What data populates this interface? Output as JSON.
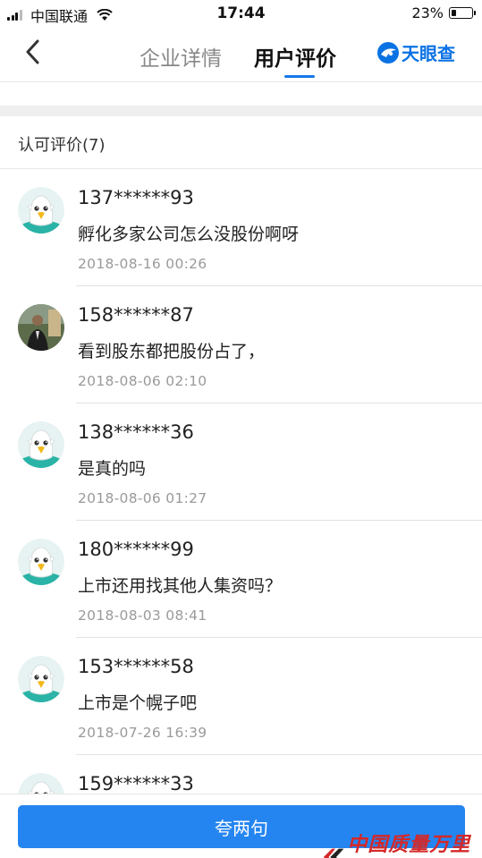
{
  "status_bar": {
    "carrier": "中国联通",
    "time": "17:44",
    "battery": "23%"
  },
  "nav": {
    "tabs": [
      "企业详情",
      "用户评价"
    ],
    "active_tab": "用户评价",
    "brand": "天眼查",
    "accent_color": "#1577e8"
  },
  "section": {
    "title": "认可评价(7)"
  },
  "reviews": [
    {
      "user": "137******93",
      "text": "孵化多家公司怎么没股份啊呀",
      "time": "2018-08-16  00:26",
      "avatar": "eagle-mascot-icon"
    },
    {
      "user": "158******87",
      "text": "看到股东都把股份占了，",
      "time": "2018-08-06  02:10",
      "avatar": "user-photo"
    },
    {
      "user": "138******36",
      "text": "是真的吗",
      "time": "2018-08-06  01:27",
      "avatar": "eagle-mascot-icon"
    },
    {
      "user": "180******99",
      "text": "上市还用找其他人集资吗？",
      "time": "2018-08-03  08:41",
      "avatar": "eagle-mascot-icon"
    },
    {
      "user": "153******58",
      "text": "上市是个幌子吧",
      "time": "2018-07-26  16:39",
      "avatar": "eagle-mascot-icon"
    },
    {
      "user": "159******33",
      "text": "",
      "time": "",
      "avatar": "eagle-mascot-icon"
    }
  ],
  "bottom": {
    "button_label": "夸两句",
    "watermark": "中国质量万里行",
    "button_color": "#2485f0"
  }
}
